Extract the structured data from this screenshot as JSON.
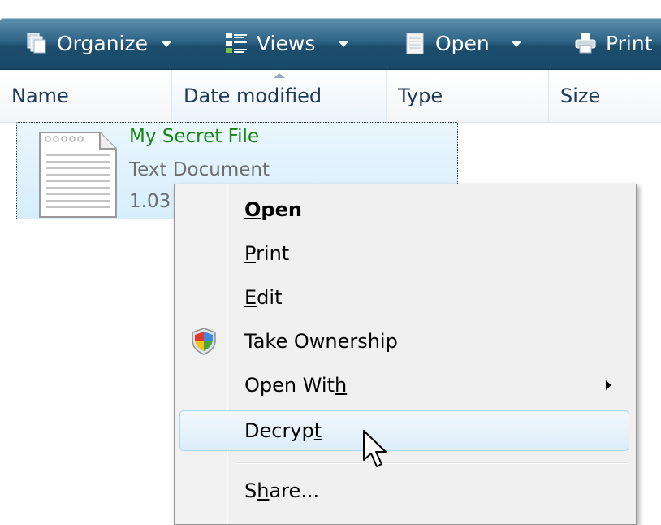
{
  "toolbar": {
    "organize_label": "Organize",
    "views_label": "Views",
    "open_label": "Open",
    "print_label": "Print"
  },
  "columns": [
    {
      "label": "Name"
    },
    {
      "label": "Date modified"
    },
    {
      "label": "Type"
    },
    {
      "label": "Size"
    }
  ],
  "file": {
    "name": "My Secret File",
    "type": "Text Document",
    "size": "1.03"
  },
  "context_menu": {
    "items": [
      {
        "pre": "",
        "accel": "O",
        "post": "pen"
      },
      {
        "pre": "",
        "accel": "P",
        "post": "rint"
      },
      {
        "pre": "",
        "accel": "E",
        "post": "dit"
      },
      {
        "pre": "Take Ownership",
        "accel": "",
        "post": ""
      },
      {
        "pre": "Open Wit",
        "accel": "h",
        "post": ""
      },
      {
        "pre": "Decryp",
        "accel": "t",
        "post": ""
      },
      {
        "pre": "S",
        "accel": "h",
        "post": "are..."
      }
    ]
  },
  "colors": {
    "toolbar": "#2e6385",
    "file_name": "#138612",
    "hover_border": "#a8d8f0"
  },
  "icons": {
    "organize": "organize-icon",
    "views": "views-icon",
    "open": "open-icon",
    "print": "printer-icon",
    "file": "text-document-icon",
    "shield": "uac-shield-icon",
    "cursor": "mouse-pointer-icon"
  }
}
